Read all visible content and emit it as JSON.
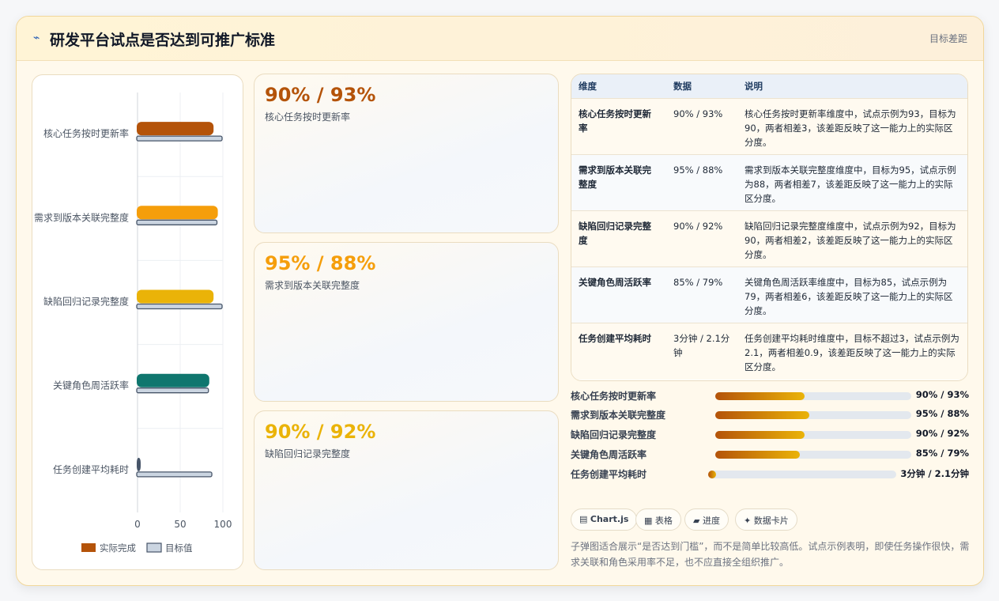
{
  "header": {
    "title": "研发平台试点是否达到可推广标准",
    "tag": "目标差距",
    "icon": "bullet-icon"
  },
  "colors": {
    "accent_dark": "#b45309",
    "accent_orange": "#f59e0b",
    "accent_yellow": "#eab308",
    "teal": "#0f766e",
    "slate": "#475569"
  },
  "stats": [
    {
      "value": "90% / 93%",
      "label": "核心任务按时更新率",
      "color": "#b45309"
    },
    {
      "value": "95% / 88%",
      "label": "需求到版本关联完整度",
      "color": "#f59e0b"
    },
    {
      "value": "90% / 92%",
      "label": "缺陷回归记录完整度",
      "color": "#eab308"
    }
  ],
  "table": {
    "headers": [
      "维度",
      "数据",
      "说明"
    ],
    "rows": [
      {
        "dim": "核心任务按时更新率",
        "data": "90% / 93%",
        "desc": "核心任务按时更新率维度中，试点示例为93，目标为90，两者相差3，该差距反映了这一能力上的实际区分度。"
      },
      {
        "dim": "需求到版本关联完整度",
        "data": "95% / 88%",
        "desc": "需求到版本关联完整度维度中，目标为95，试点示例为88，两者相差7，该差距反映了这一能力上的实际区分度。"
      },
      {
        "dim": "缺陷回归记录完整度",
        "data": "90% / 92%",
        "desc": "缺陷回归记录完整度维度中，试点示例为92，目标为90，两者相差2，该差距反映了这一能力上的实际区分度。"
      },
      {
        "dim": "关键角色周活跃率",
        "data": "85% / 79%",
        "desc": "关键角色周活跃率维度中，目标为85，试点示例为79，两者相差6，该差距反映了这一能力上的实际区分度。"
      },
      {
        "dim": "任务创建平均耗时",
        "data": "3分钟 / 2.1分钟",
        "desc": "任务创建平均耗时维度中，目标不超过3，试点示例为2.1，两者相差0.9，该差距反映了这一能力上的实际区分度。"
      }
    ]
  },
  "progress": [
    {
      "label": "核心任务按时更新率",
      "value": "90% / 93%",
      "fill": 0.455
    },
    {
      "label": "需求到版本关联完整度",
      "value": "95% / 88%",
      "fill": 0.478
    },
    {
      "label": "缺陷回归记录完整度",
      "value": "90% / 92%",
      "fill": 0.455
    },
    {
      "label": "关键角色周活跃率",
      "value": "85% / 79%",
      "fill": 0.43
    },
    {
      "label": "任务创建平均耗时",
      "value": "3分钟 / 2.1分钟",
      "fill": 0.04
    }
  ],
  "chips": [
    {
      "icon": "chart-icon",
      "label": "Chart.js"
    },
    {
      "icon": "table-icon",
      "label": "表格"
    },
    {
      "icon": "progress-icon",
      "label": "进度"
    },
    {
      "icon": "sparkle-icon",
      "label": "数据卡片"
    }
  ],
  "note": "子弹图适合展示“是否达到门槛”，而不是简单比较高低。试点示例表明，即使任务操作很快，需求关联和角色采用率不足，也不应直接全组织推广。",
  "chart_data": {
    "type": "bar",
    "orientation": "horizontal",
    "categories": [
      "核心任务按时更新率",
      "需求到版本关联完整度",
      "缺陷回归记录完整度",
      "关键角色周活跃率",
      "任务创建平均耗时"
    ],
    "series": [
      {
        "name": "实际完成",
        "values": [
          90,
          95,
          90,
          85,
          3
        ],
        "colors": [
          "#b45309",
          "#f59e0b",
          "#eab308",
          "#0f766e",
          "#475569"
        ]
      },
      {
        "name": "目标值",
        "values": [
          100,
          94,
          100,
          84,
          88
        ],
        "color": "#cbd5e1"
      }
    ],
    "xticks": [
      "0",
      "50",
      "100"
    ],
    "xlim": [
      0,
      100
    ],
    "legend": "bottom",
    "grid": true
  }
}
